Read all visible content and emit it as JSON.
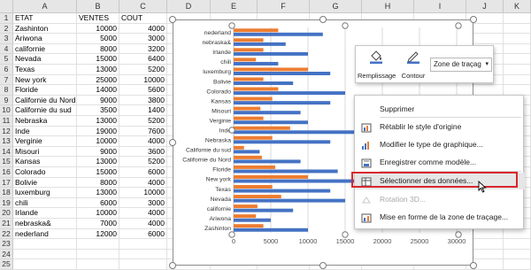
{
  "columns": [
    "A",
    "B",
    "C",
    "D",
    "E",
    "F",
    "G",
    "H",
    "I",
    "J",
    "K"
  ],
  "table": {
    "headers": [
      "ETAT",
      "VENTES",
      "COUT"
    ],
    "rows": [
      [
        "Zashinton",
        "10000",
        "4000"
      ],
      [
        "Ariwona",
        "5000",
        "3000"
      ],
      [
        "californie",
        "8000",
        "3200"
      ],
      [
        "Nevada",
        "15000",
        "6400"
      ],
      [
        "Texas",
        "13000",
        "5200"
      ],
      [
        "New york",
        "25000",
        "10000"
      ],
      [
        "Floride",
        "14000",
        "5600"
      ],
      [
        "Californie du Nord",
        "9000",
        "3800"
      ],
      [
        "Californie du sud",
        "3500",
        "1400"
      ],
      [
        "Nebraska",
        "13000",
        "5200"
      ],
      [
        "Inde",
        "19000",
        "7600"
      ],
      [
        "Verginie",
        "10000",
        "4000"
      ],
      [
        "Misouri",
        "9000",
        "3600"
      ],
      [
        "Kansas",
        "13000",
        "5200"
      ],
      [
        "Colorado",
        "15000",
        "6000"
      ],
      [
        "Bolivie",
        "8000",
        "4000"
      ],
      [
        "luxemburg",
        "13000",
        "10000"
      ],
      [
        "chili",
        "6000",
        "3000"
      ],
      [
        "Irlande",
        "10000",
        "4000"
      ],
      [
        "nebraska&",
        "7000",
        "4000"
      ],
      [
        "nederland",
        "12000",
        "6000"
      ]
    ]
  },
  "chart_data": {
    "type": "bar",
    "orientation": "horizontal",
    "categories": [
      "nederland",
      "nebraska&",
      "Irlande",
      "chili",
      "luxemburg",
      "Bolivie",
      "Colorado",
      "Kansas",
      "Misouri",
      "Verginie",
      "Inde",
      "Nebraska",
      "Californie du sud",
      "Californie du Nord",
      "Floride",
      "New york",
      "Texas",
      "Nevada",
      "californie",
      "Ariwona",
      "Zashinton"
    ],
    "series": [
      {
        "values": [
          12000,
          7000,
          10000,
          6000,
          13000,
          8000,
          15000,
          13000,
          9000,
          10000,
          19000,
          13000,
          3500,
          9000,
          14000,
          25000,
          13000,
          15000,
          8000,
          5000,
          10000
        ],
        "color": "#4472c4"
      },
      {
        "values": [
          6000,
          4000,
          4000,
          3000,
          10000,
          4000,
          6000,
          5200,
          3600,
          4000,
          7600,
          5200,
          1400,
          3800,
          5600,
          10000,
          5200,
          6400,
          3200,
          3000,
          4000
        ],
        "color": "#ed7d31"
      }
    ],
    "x_ticks": [
      "0",
      "5000",
      "10000",
      "15000",
      "20000",
      "25000",
      "30000"
    ],
    "xlim": [
      0,
      30000
    ],
    "grid": true
  },
  "toolbar": {
    "fill_label": "Remplissage",
    "outline_label": "Contour",
    "dropdown_value": "Zone de traçag"
  },
  "context_menu": {
    "items": [
      {
        "label": "Supprimer",
        "icon": "none",
        "state": "normal"
      },
      {
        "label": "Rétablir le style d'origine",
        "icon": "reset-style-icon",
        "state": "normal"
      },
      {
        "label": "Modifier le type de graphique...",
        "icon": "change-chart-type-icon",
        "state": "normal"
      },
      {
        "label": "Enregistrer comme modèle...",
        "icon": "save-template-icon",
        "state": "normal"
      },
      {
        "label": "Sélectionner des données...",
        "icon": "select-data-icon",
        "state": "highlighted"
      },
      {
        "label": "Rotation 3D...",
        "icon": "rotation-3d-icon",
        "state": "disabled"
      },
      {
        "label": "Mise en forme de la zone de traçage...",
        "icon": "format-plot-area-icon",
        "state": "normal"
      }
    ]
  },
  "colors": {
    "series1": "#4472c4",
    "series2": "#ed7d31",
    "highlight_border": "#d9262e"
  }
}
